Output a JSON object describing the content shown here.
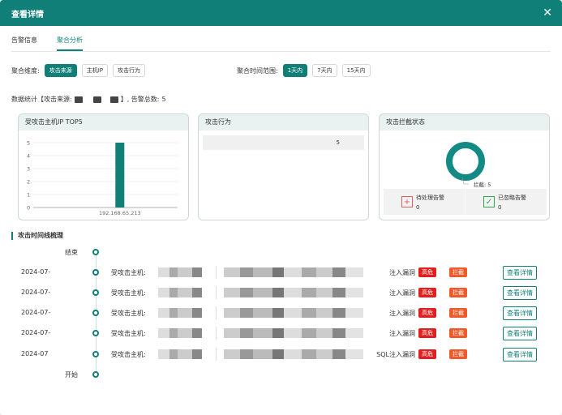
{
  "dialog": {
    "title": "查看详情",
    "close_icon": "close-icon"
  },
  "tabs": [
    {
      "label": "告警信息",
      "active": false
    },
    {
      "label": "聚合分析",
      "active": true
    }
  ],
  "filters": {
    "dimension_label": "聚合维度:",
    "dimensions": [
      {
        "label": "攻击来源",
        "active": true
      },
      {
        "label": "主机IP",
        "active": false
      },
      {
        "label": "攻击行为",
        "active": false
      }
    ],
    "time_label": "聚合时间范围:",
    "times": [
      {
        "label": "1天内",
        "active": true
      },
      {
        "label": "7天内",
        "active": false
      },
      {
        "label": "15天内",
        "active": false
      }
    ]
  },
  "stats": {
    "prefix": "数据统计【攻击来源:",
    "suffix": "】, 告警总数:",
    "total": "5"
  },
  "cards": {
    "top5": {
      "title": "受攻击主机IP TOP5"
    },
    "behavior": {
      "title": "攻击行为",
      "count": "5"
    },
    "block": {
      "title": "攻击拦截状态",
      "donut_label": "拦截: 5",
      "pending_label": "待处理告警",
      "pending_count": "0",
      "ignored_label": "已忽略告警",
      "ignored_count": "0"
    }
  },
  "chart_data": {
    "type": "bar",
    "categories": [
      "192.168.65.213"
    ],
    "values": [
      5
    ],
    "ylim": [
      0,
      5
    ],
    "yticks": [
      "0",
      "1",
      "2",
      "3",
      "4",
      "5"
    ],
    "grid": true,
    "colors": {
      "bar": "#0f7f78"
    }
  },
  "donut": {
    "blocked": 5,
    "total": 5,
    "color": "#148a84"
  },
  "timeline": {
    "title": "攻击时间线梳理",
    "end_label": "结束",
    "start_label": "开始",
    "rows": [
      {
        "date": "2024-07-",
        "host_label": "受攻击主机:",
        "vuln": "注入漏洞",
        "risk": "高危",
        "status": "拦截",
        "action": "查看详情"
      },
      {
        "date": "2024-07-",
        "host_label": "受攻击主机:",
        "vuln": "注入漏洞",
        "risk": "高危",
        "status": "拦截",
        "action": "查看详情"
      },
      {
        "date": "2024-07-",
        "host_label": "受攻击主机:",
        "vuln": "注入漏洞",
        "risk": "高危",
        "status": "拦截",
        "action": "查看详情"
      },
      {
        "date": "2024-07-",
        "host_label": "受攻击主机:",
        "vuln": "注入漏洞",
        "risk": "高危",
        "status": "拦截",
        "action": "查看详情"
      },
      {
        "date": "2024-07",
        "host_label": "受攻击主机:",
        "vuln": "SQL注入漏洞",
        "risk": "高危",
        "status": "拦截",
        "action": "查看详情"
      }
    ]
  },
  "colors": {
    "primary": "#0f7f78",
    "risk": "#e02020",
    "block": "#f05a28"
  }
}
